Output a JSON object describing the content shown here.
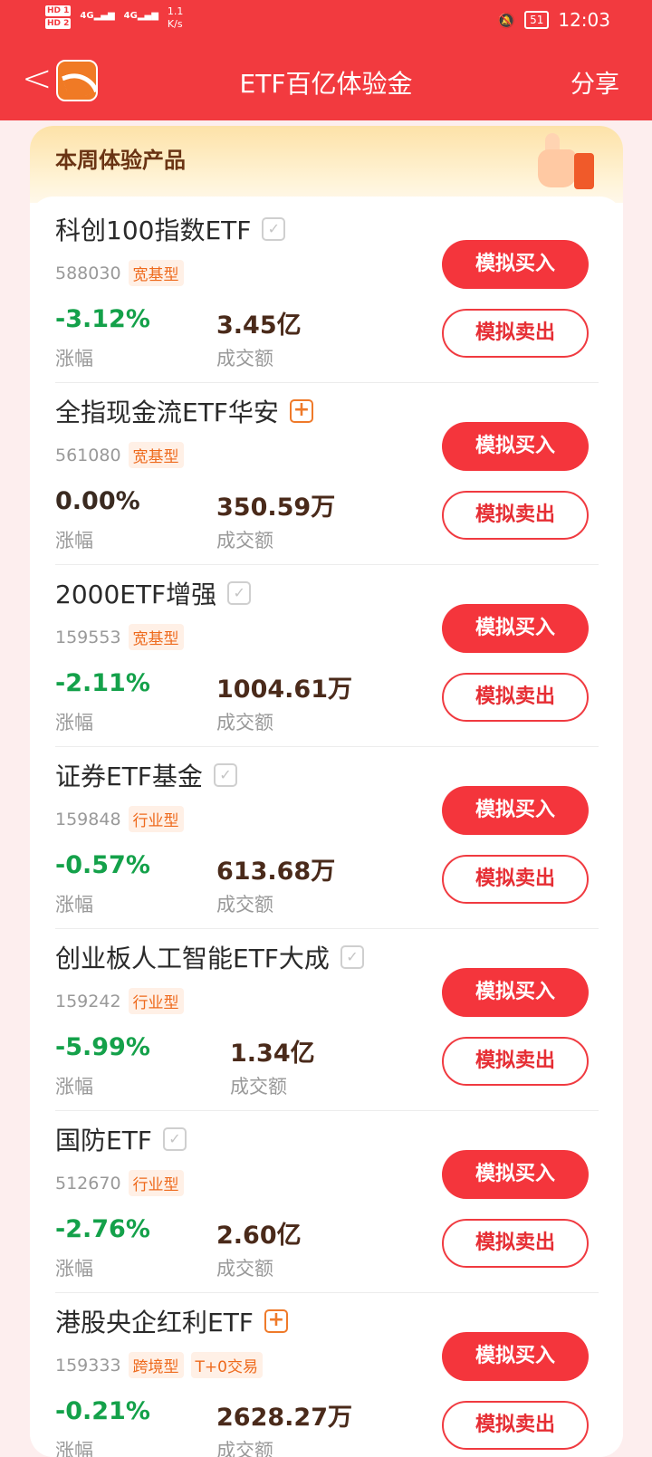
{
  "status_bar": {
    "hd1": "HD 1",
    "hd2": "HD 2",
    "signal1": "4G",
    "signal2": "4G",
    "net_speed": "1.1",
    "net_unit": "K/s",
    "battery": "51",
    "time": "12:03"
  },
  "nav": {
    "title": "ETF百亿体验金",
    "share_label": "分享"
  },
  "section": {
    "title": "本周体验产品"
  },
  "labels": {
    "change": "涨幅",
    "volume": "成交额",
    "buy": "模拟买入",
    "sell": "模拟卖出"
  },
  "items": [
    {
      "name": "科创100指数ETF",
      "icon": "check",
      "code": "588030",
      "tags": [
        "宽基型"
      ],
      "change": "-3.12%",
      "direction": "down",
      "volume": "3.45亿"
    },
    {
      "name": "全指现金流ETF华安",
      "icon": "plus",
      "code": "561080",
      "tags": [
        "宽基型"
      ],
      "change": "0.00%",
      "direction": "flat",
      "volume": "350.59万"
    },
    {
      "name": "2000ETF增强",
      "icon": "check",
      "code": "159553",
      "tags": [
        "宽基型"
      ],
      "change": "-2.11%",
      "direction": "down",
      "volume": "1004.61万"
    },
    {
      "name": "证券ETF基金",
      "icon": "check",
      "code": "159848",
      "tags": [
        "行业型"
      ],
      "change": "-0.57%",
      "direction": "down",
      "volume": "613.68万"
    },
    {
      "name": "创业板人工智能ETF大成",
      "icon": "check",
      "code": "159242",
      "tags": [
        "行业型"
      ],
      "change": "-5.99%",
      "direction": "down",
      "volume": "1.34亿"
    },
    {
      "name": "国防ETF",
      "icon": "check",
      "code": "512670",
      "tags": [
        "行业型"
      ],
      "change": "-2.76%",
      "direction": "down",
      "volume": "2.60亿"
    },
    {
      "name": "港股央企红利ETF",
      "icon": "plus",
      "code": "159333",
      "tags": [
        "跨境型",
        "T+0交易"
      ],
      "change": "-0.21%",
      "direction": "down",
      "volume": "2628.27万"
    }
  ],
  "colors": {
    "brand_red": "#f23a3f",
    "down_green": "#14a14a",
    "tag_orange": "#ee6a1d"
  }
}
